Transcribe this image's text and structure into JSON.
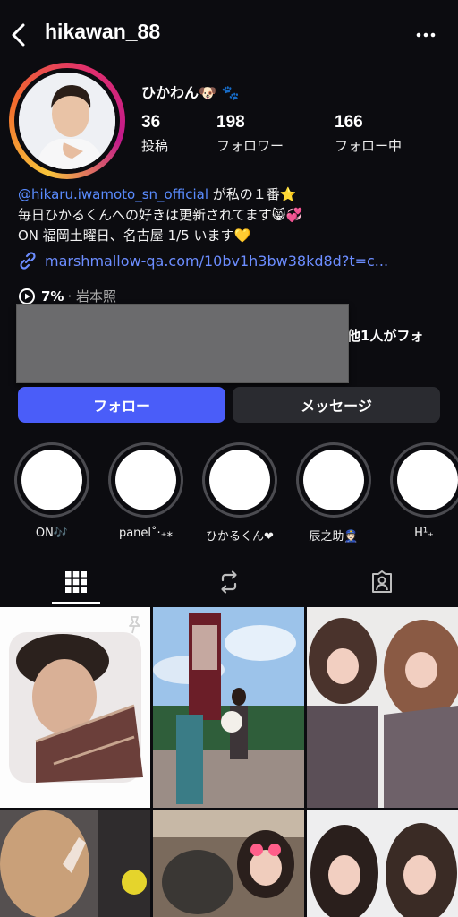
{
  "header": {
    "username": "hikawan_88",
    "back_icon": "chevron-left-icon",
    "more_icon": "more-horizontal-icon"
  },
  "profile": {
    "display_name": "ひかわん🐶 🐾",
    "stats": [
      {
        "value": "36",
        "label": "投稿"
      },
      {
        "value": "198",
        "label": "フォロワー"
      },
      {
        "value": "166",
        "label": "フォロー中"
      }
    ],
    "bio": {
      "mention": "@hikaru.iwamoto_sn_official",
      "line1_rest": " が私の１番⭐",
      "line2": "毎日ひかるくんへの好きは更新されてます😸💞",
      "line3": "ON 福岡土曜日、名古屋 1/5 います💛"
    },
    "link": "marshmallow-qa.com/10bv1h3bw38kd8d?t=c...",
    "threads": {
      "percent": "7%",
      "name": "· 岩本照"
    },
    "mutual_tail": "他1人がフォ"
  },
  "buttons": {
    "follow": "フォロー",
    "message": "メッセージ"
  },
  "highlights": [
    {
      "label": "ON🎶"
    },
    {
      "label": "panel˚‧₊⁎"
    },
    {
      "label": "ひかるくん❤"
    },
    {
      "label": "辰之助👮🏻"
    },
    {
      "label": "H¹₊"
    }
  ],
  "tabs": [
    {
      "name": "grid",
      "icon": "grid-icon",
      "active": true
    },
    {
      "name": "reels",
      "icon": "repost-icon",
      "active": false
    },
    {
      "name": "tagged",
      "icon": "tagged-person-icon",
      "active": false
    }
  ],
  "colors": {
    "background": "#0c0c10",
    "accent_blue": "#4a5df9",
    "link_blue": "#6c8dff",
    "secondary_button": "#2a2b30"
  }
}
